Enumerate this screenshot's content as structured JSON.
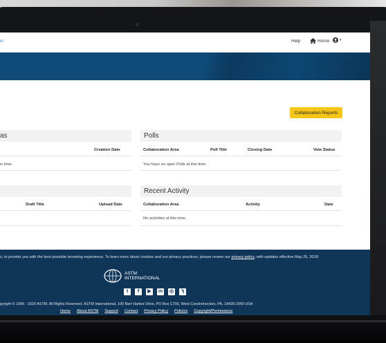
{
  "nav": {
    "brand_fragment": "er",
    "help": "Help",
    "home": "Home"
  },
  "actions": {
    "reports_button": "Collaboration Reports"
  },
  "panels": {
    "collab_areas": {
      "title": "as",
      "col_creation_date": "Creation Date",
      "empty": "is time."
    },
    "polls": {
      "title": "Polls",
      "columns": [
        "Collaboration Area",
        "Poll Title",
        "Closing Date",
        "Vote Status"
      ],
      "empty": "You have no open Polls at this time."
    },
    "drafts": {
      "col_draft_title": "Draft Title",
      "col_upload_date": "Upload Date"
    },
    "recent_activity": {
      "title": "Recent Activity",
      "columns": [
        "Collaboration Area",
        "Activity",
        "Date"
      ],
      "empty": "No activities at this time."
    }
  },
  "footer": {
    "cookie_before": "s, to provide you with the best possible browsing experience. To learn more about cookies and our privacy practices, please review our ",
    "cookie_link": "privacy policy",
    "cookie_after": ", with updates effective May 25, 2018.",
    "logo_line1": "ASTM",
    "logo_line2": "INTERNATIONAL",
    "socials": [
      "twitter-icon",
      "facebook-icon",
      "youtube-icon",
      "linkedin-icon",
      "instagram-icon",
      "rss-icon"
    ],
    "copyright": "pyright © 1996 - 2020 ASTM. All Rights Reserved. ASTM International, 100 Barr Harbor Drive, PO Box C700, West Conshohocken, PA, 19428-2959 USA",
    "links": [
      "Home",
      "About ASTM",
      "Support",
      "Contact",
      "Privacy Policy",
      "Policies",
      "Copyright/Permissions"
    ]
  },
  "colors": {
    "banner": "#0f4a78",
    "footer": "#0f3558",
    "accent_button": "#f5c518",
    "link": "#2f8fd0"
  }
}
